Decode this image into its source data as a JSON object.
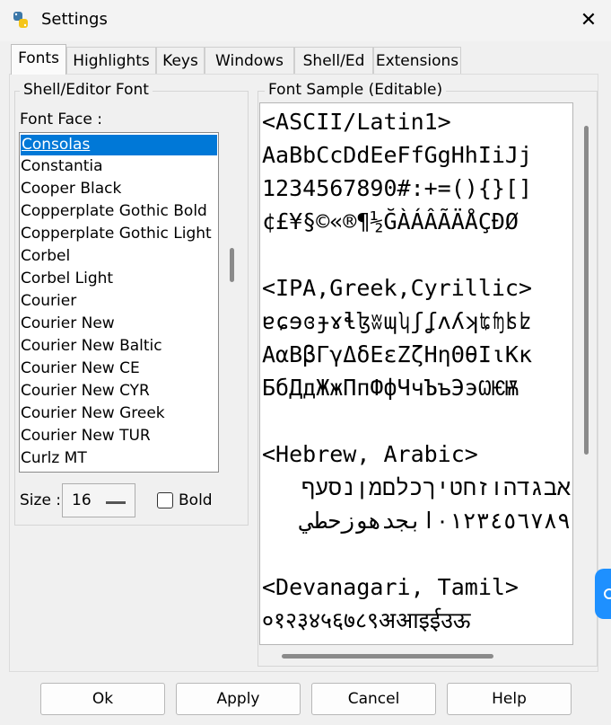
{
  "window": {
    "title": "Settings",
    "close_glyph": "✕"
  },
  "tabs": [
    "Fonts",
    "Highlights",
    "Keys",
    "Windows",
    "Shell/Ed",
    "Extensions"
  ],
  "font_group": {
    "label": "Shell/Editor Font",
    "face_label": "Font Face :",
    "fonts": [
      "Consolas",
      "Constantia",
      "Cooper Black",
      "Copperplate Gothic Bold",
      "Copperplate Gothic Light",
      "Corbel",
      "Corbel Light",
      "Courier",
      "Courier New",
      "Courier New Baltic",
      "Courier New CE",
      "Courier New CYR",
      "Courier New Greek",
      "Courier New TUR",
      "Curlz MT"
    ],
    "selected_font": "Consolas",
    "size_label": "Size :",
    "size_value": "16",
    "bold_label": "Bold",
    "bold_checked": false
  },
  "sample_group": {
    "label": "Font Sample (Editable)",
    "lines": [
      "<ASCII/Latin1>",
      "AaBbCcDdEeFfGgHhIiJj",
      "1234567890#:+=(){}[]",
      "¢£¥§©«®¶½ĞÀÁÂÃÄÅÇÐØ",
      "",
      "<IPA,Greek,Cyrillic>",
      "ɐɕɘɞɟɤɬɮʬɰʮʃʆʌʎʞʨʩʪʫ",
      "ΑαΒβΓγΔδΕεΖζΗηΘθΙιΚκ",
      "БбДдЖжПпФфЧчЪъЭэѠѤѬ",
      "",
      "<Hebrew, Arabic>",
      "אבגדהוזחטיךכלםמןנסעף",
      "٠١٢٣٤٥٦٧٨٩ابجدهوزحطي",
      "",
      "<Devanagari, Tamil>",
      "०१२३४५६७८९अआइईउऊ"
    ]
  },
  "buttons": {
    "ok": "Ok",
    "apply": "Apply",
    "cancel": "Cancel",
    "help": "Help"
  },
  "colors": {
    "selection": "#0078d7",
    "edge_badge": "#1e90ff"
  }
}
